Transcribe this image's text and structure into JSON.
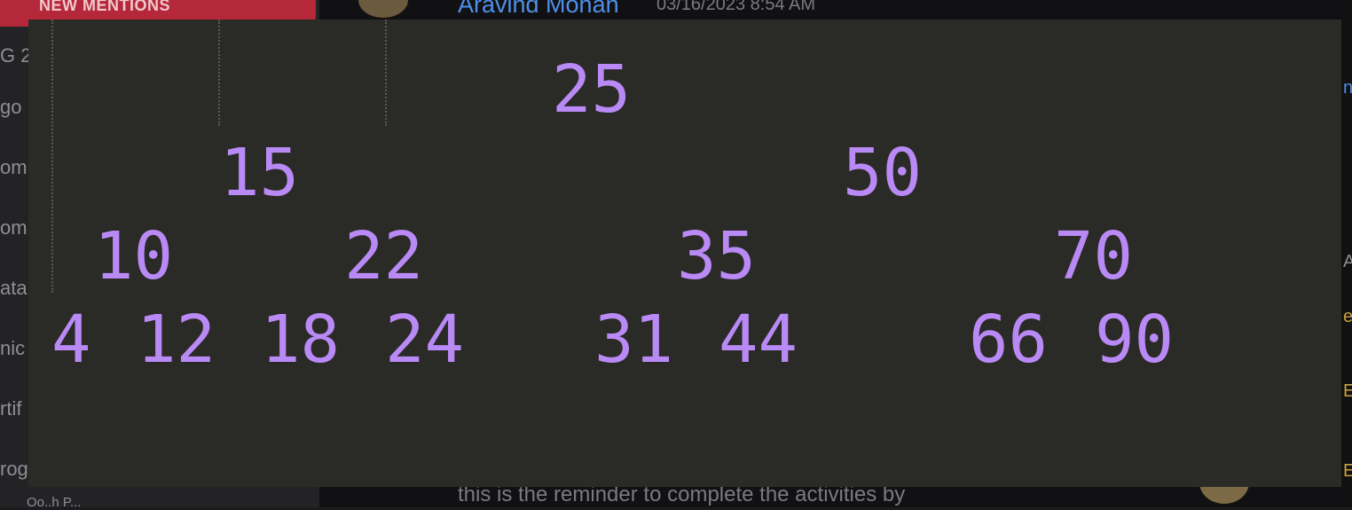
{
  "background": {
    "sidebar": {
      "mentions_label": "NEW MENTIONS",
      "items": [
        "G 2",
        "go",
        "om",
        "om",
        "ata",
        "nic",
        "rtif",
        "rog"
      ],
      "footer": "Oo..h  P..."
    },
    "message": {
      "author": "Aravind Mohan",
      "timestamp": "03/16/2023 8:54 AM",
      "body_partial": "this is the reminder to complete the activities by"
    },
    "right_edge": [
      "n",
      "A",
      "e",
      "E",
      "E"
    ]
  },
  "code_block": {
    "text_color": "#b98af5",
    "panel_color": "#2a2a26",
    "tree_lines": [
      "25",
      "15          50",
      "10    22        35        70",
      "4 12 18 24   31 44     66 90"
    ],
    "nodes": {
      "root": "25",
      "l1_left": "15",
      "l1_right": "50",
      "l2_a": "10",
      "l2_b": "22",
      "l2_c": "35",
      "l2_d": "70",
      "l3_a": "4",
      "l3_b": "12",
      "l3_c": "18",
      "l3_d": "24",
      "l3_e": "31",
      "l3_f": "44",
      "l3_g": "66",
      "l3_h": "90"
    }
  }
}
